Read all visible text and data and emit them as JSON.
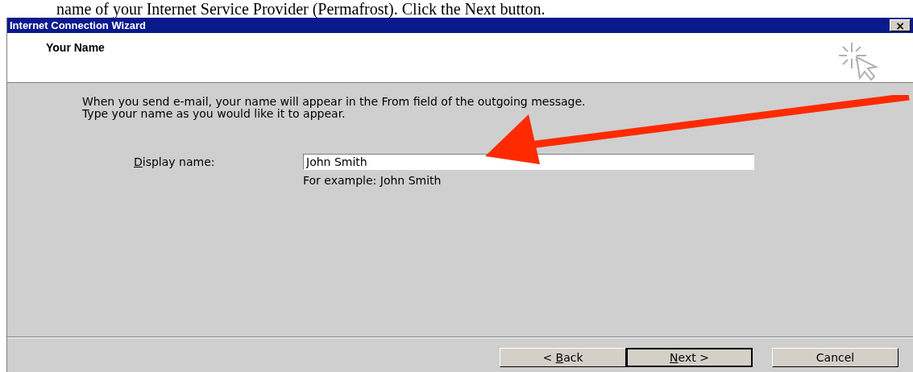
{
  "document_caption": "name of your Internet Service Provider (Permafrost).  Click the Next button.",
  "window": {
    "title": "Internet Connection Wizard",
    "close": "×"
  },
  "header": {
    "title": "Your Name"
  },
  "instructions": [
    "When you send e-mail, your name will appear in the From field of the outgoing message.",
    "Type your name as you would like it to appear."
  ],
  "display_name": {
    "label": [
      {
        "text": "D",
        "underlined": true
      },
      {
        "text": "isplay name:",
        "underlined": false
      }
    ],
    "value": "John Smith",
    "hint": "For example: John Smith"
  },
  "buttons": [
    {
      "label": [
        {
          "text": "< ",
          "underlined": false
        },
        {
          "text": "B",
          "underlined": true
        },
        {
          "text": "ack",
          "underlined": false
        }
      ],
      "default": false
    },
    {
      "label": [
        {
          "text": "N",
          "underlined": true
        },
        {
          "text": "ext >",
          "underlined": false
        }
      ],
      "default": true
    },
    {
      "label": [
        {
          "text": "Cancel",
          "underlined": false
        }
      ],
      "default": false
    }
  ]
}
